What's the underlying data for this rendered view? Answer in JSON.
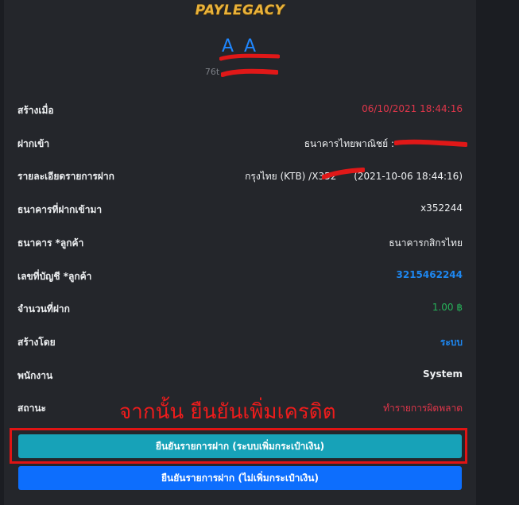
{
  "brand": {
    "logo_text": "PAYLEGACY",
    "color": "#e9b23a"
  },
  "user": {
    "name": "A A",
    "id_prefix": "76t"
  },
  "details": [
    {
      "label": "สร้างเมื่อ",
      "value": "06/10/2021 18:44:16",
      "style": "red"
    },
    {
      "label": "ฝากเข้า",
      "value": "ธนาคารไทยพาณิชย์ :",
      "style": "normal"
    },
    {
      "label": "รายละเอียดรายการฝาก",
      "value_prefix": "กรุงไทย (KTB) /X352",
      "value_suffix": "(2021-10-06 18:44:16)",
      "style": "normal"
    },
    {
      "label": "ธนาคารที่ฝากเข้ามา",
      "value": "x352244",
      "style": "normal"
    },
    {
      "label": "ธนาคาร *ลูกค้า",
      "value": "ธนาคารกสิกรไทย",
      "style": "normal"
    },
    {
      "label": "เลขที่บัญชี *ลูกค้า",
      "value": "3215462244",
      "style": "blue"
    },
    {
      "label": "จำนวนที่ฝาก",
      "value": "1.00 ฿",
      "style": "green"
    },
    {
      "label": "สร้างโดย",
      "value": "ระบบ",
      "style": "blue"
    },
    {
      "label": "พนักงาน",
      "value": "System",
      "style": "normal"
    },
    {
      "label": "สถานะ",
      "value": "ทำรายการผิดพลาด",
      "style": "red"
    }
  ],
  "annotation": "จากนั้น ยืนยันเพิ่มเครดิต",
  "buttons": {
    "confirm_with_wallet": "ยืนยันรายการฝาก (ระบบเพิ่มกระเป๋าเงิน)",
    "confirm_without_wallet": "ยืนยันรายการฝาก (ไม่เพิ่มกระเป๋าเงิน)"
  },
  "colors": {
    "background": "#1b1d22",
    "panel": "#24262b",
    "accent_blue": "#1e87f0",
    "danger_red": "#e0364a",
    "success_green": "#27b35a",
    "teal_button": "#17a2b8",
    "primary_button": "#0d6efd",
    "annotation_red": "#ee1c1c"
  }
}
